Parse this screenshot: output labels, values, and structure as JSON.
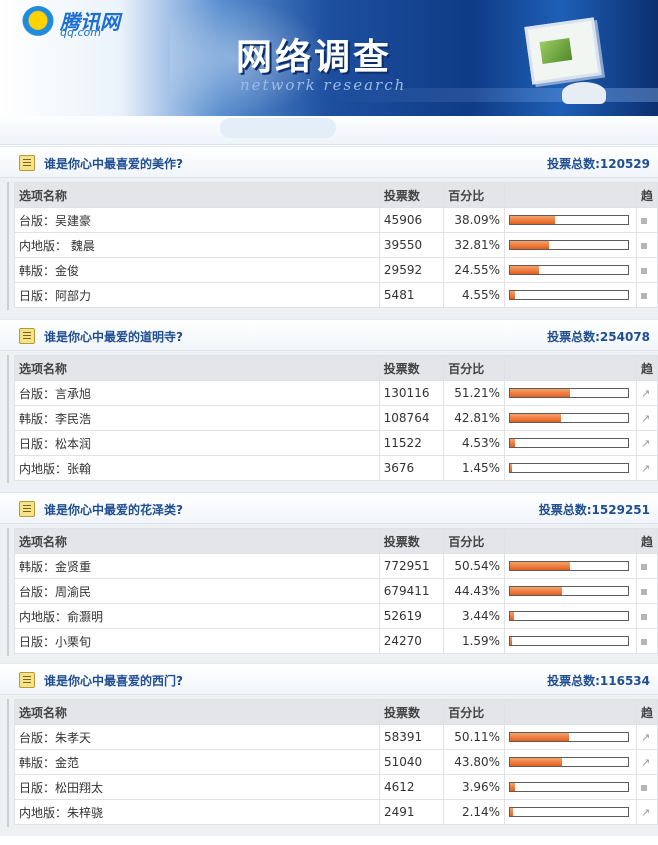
{
  "banner": {
    "logo_text": "腾讯网",
    "logo_sub": "qq.com",
    "title": "网络调查",
    "subtitle": "network research"
  },
  "table_headers": {
    "name": "选项名称",
    "votes": "投票数",
    "percent": "百分比",
    "trend": "趋"
  },
  "colors": {
    "bar_fill": "#e65f1d",
    "header_text": "#1f4e91",
    "header_bg": "#e3e5e8"
  },
  "surveys": [
    {
      "question": "谁是你心中最喜爱的美作?",
      "total": "投票总数:120529",
      "options": [
        {
          "name": "台版：吴建豪",
          "votes": "45906",
          "percent": "38.09%",
          "ratio": 0.3809,
          "trend": "square-icon"
        },
        {
          "name": "内地版： 魏晨",
          "votes": "39550",
          "percent": "32.81%",
          "ratio": 0.3281,
          "trend": "square-icon"
        },
        {
          "name": "韩版：金俊",
          "votes": "29592",
          "percent": "24.55%",
          "ratio": 0.2455,
          "trend": "square-icon"
        },
        {
          "name": "日版：阿部力",
          "votes": "5481",
          "percent": "4.55%",
          "ratio": 0.0455,
          "trend": "square-icon"
        }
      ]
    },
    {
      "question": "谁是你心中最爱的道明寺?",
      "total": "投票总数:254078",
      "options": [
        {
          "name": "台版：言承旭",
          "votes": "130116",
          "percent": "51.21%",
          "ratio": 0.5121,
          "trend": "up-arrow-icon"
        },
        {
          "name": "韩版：李民浩",
          "votes": "108764",
          "percent": "42.81%",
          "ratio": 0.4281,
          "trend": "up-arrow-icon"
        },
        {
          "name": "日版：松本润",
          "votes": "11522",
          "percent": "4.53%",
          "ratio": 0.0453,
          "trend": "up-arrow-icon"
        },
        {
          "name": "内地版：张翰",
          "votes": "3676",
          "percent": "1.45%",
          "ratio": 0.0145,
          "trend": "up-arrow-icon"
        }
      ]
    },
    {
      "question": "谁是你心中最爱的花泽类?",
      "total": "投票总数:1529251",
      "options": [
        {
          "name": "韩版：金贤重",
          "votes": "772951",
          "percent": "50.54%",
          "ratio": 0.5054,
          "trend": "square-icon"
        },
        {
          "name": "台版：周渝民",
          "votes": "679411",
          "percent": "44.43%",
          "ratio": 0.4443,
          "trend": "square-icon"
        },
        {
          "name": "内地版：俞灏明",
          "votes": "52619",
          "percent": "3.44%",
          "ratio": 0.0344,
          "trend": "square-icon"
        },
        {
          "name": "日版：小栗旬",
          "votes": "24270",
          "percent": "1.59%",
          "ratio": 0.0159,
          "trend": "square-icon"
        }
      ]
    },
    {
      "question": "谁是你心中最喜爱的西门?",
      "total": "投票总数:116534",
      "options": [
        {
          "name": "台版：朱孝天",
          "votes": "58391",
          "percent": "50.11%",
          "ratio": 0.5011,
          "trend": "up-arrow-icon"
        },
        {
          "name": "韩版：金范",
          "votes": "51040",
          "percent": "43.80%",
          "ratio": 0.438,
          "trend": "up-arrow-icon"
        },
        {
          "name": "日版：松田翔太",
          "votes": "4612",
          "percent": "3.96%",
          "ratio": 0.0396,
          "trend": "square-icon"
        },
        {
          "name": "内地版：朱梓骁",
          "votes": "2491",
          "percent": "2.14%",
          "ratio": 0.0214,
          "trend": "up-arrow-icon"
        }
      ]
    }
  ]
}
